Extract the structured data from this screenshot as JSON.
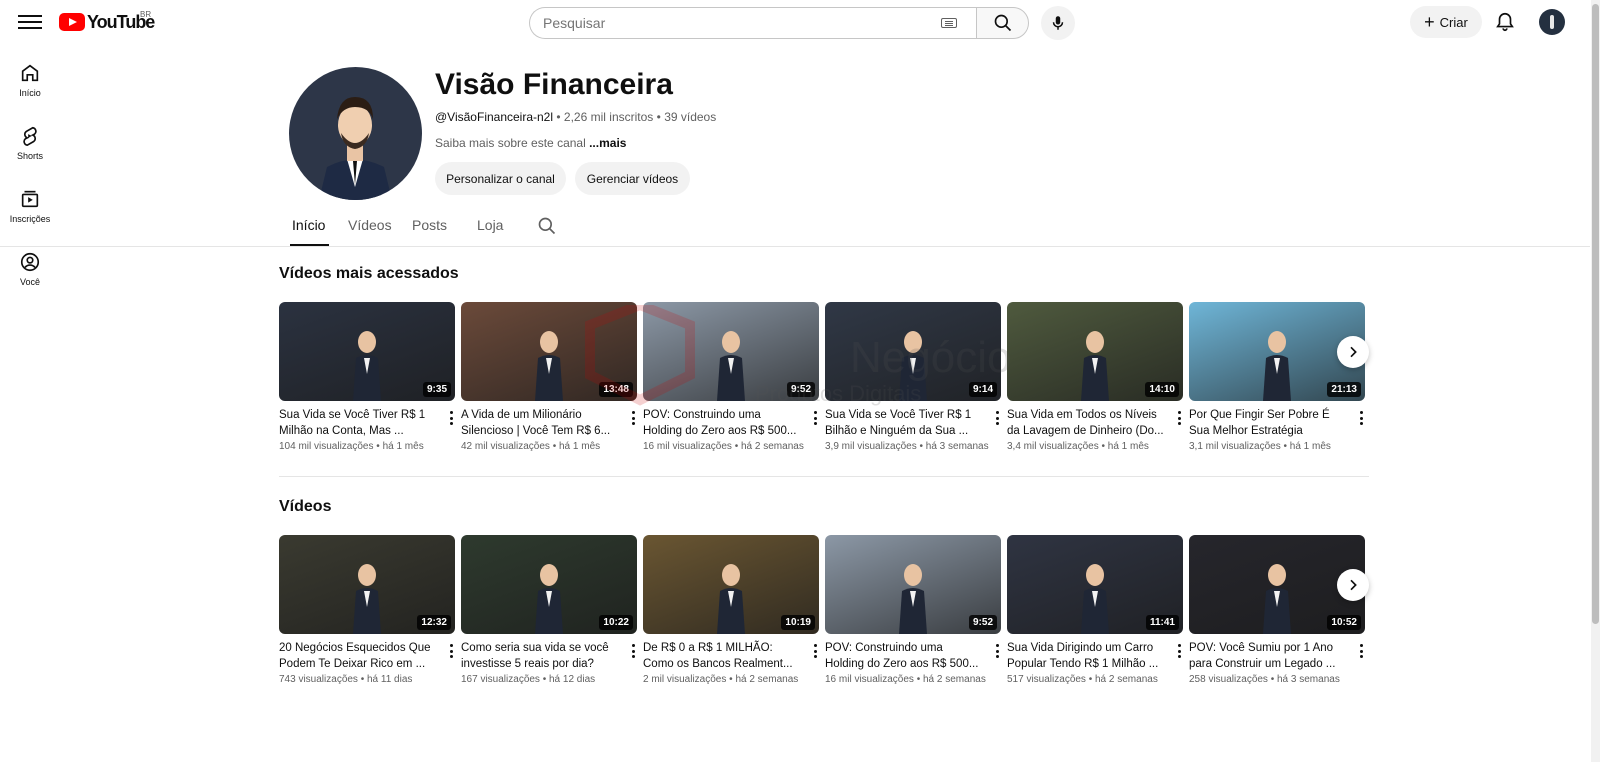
{
  "topbar": {
    "logo_text": "YouTube",
    "country": "BR",
    "search_placeholder": "Pesquisar",
    "create_label": "Criar"
  },
  "leftnav": [
    {
      "label": "Início",
      "icon": "home-icon"
    },
    {
      "label": "Shorts",
      "icon": "shorts-icon"
    },
    {
      "label": "Inscrições",
      "icon": "subscriptions-icon"
    },
    {
      "label": "Você",
      "icon": "user-icon"
    }
  ],
  "channel": {
    "name": "Visão Financeira",
    "handle": "@VisãoFinanceira-n2l",
    "subscribers": "2,26 mil inscritos",
    "videos_count": "39 vídeos",
    "description": "Saiba mais sobre este canal",
    "more": "...mais",
    "customize_label": "Personalizar o canal",
    "manage_label": "Gerenciar vídeos"
  },
  "tabs": [
    {
      "label": "Início",
      "active": true
    },
    {
      "label": "Vídeos",
      "active": false
    },
    {
      "label": "Posts",
      "active": false
    },
    {
      "label": "Loja",
      "active": false
    }
  ],
  "popular": {
    "title": "Vídeos mais acessados",
    "videos": [
      {
        "title": "Sua Vida se Você Tiver R$ 1 Milhão na Conta, Mas ...",
        "views": "104 mil visualizações",
        "age": "há 1 mês",
        "duration": "9:35",
        "thumb": "#2b3240"
      },
      {
        "title": "A Vida de um Milionário Silencioso | Você Tem R$ 6...",
        "views": "42 mil visualizações",
        "age": "há 1 mês",
        "duration": "13:48",
        "thumb": "#6b4a3a"
      },
      {
        "title": "POV: Construindo uma Holding do Zero aos R$ 500...",
        "views": "16 mil visualizações",
        "age": "há 2 semanas",
        "duration": "9:52",
        "thumb": "#8c98a6"
      },
      {
        "title": "Sua Vida se Você Tiver R$ 1 Bilhão e Ninguém da Sua ...",
        "views": "3,9 mil visualizações",
        "age": "há 3 semanas",
        "duration": "9:14",
        "thumb": "#303846"
      },
      {
        "title": "Sua Vida em Todos os Níveis da Lavagem de Dinheiro (Do...",
        "views": "3,4 mil visualizações",
        "age": "há 1 mês",
        "duration": "14:10",
        "thumb": "#4f5a3e"
      },
      {
        "title": "Por Que Fingir Ser Pobre É Sua Melhor Estratégia",
        "views": "3,1 mil visualizações",
        "age": "há 1 mês",
        "duration": "21:13",
        "thumb": "#6fb6d8"
      }
    ]
  },
  "videos": {
    "title": "Vídeos",
    "videos": [
      {
        "title": "20 Negócios Esquecidos Que Podem Te Deixar Rico em ...",
        "views": "743 visualizações",
        "age": "há 11 dias",
        "duration": "12:32",
        "thumb": "#3a3a30"
      },
      {
        "title": "Como seria sua vida se você investisse 5 reais por dia?",
        "views": "167 visualizações",
        "age": "há 12 dias",
        "duration": "10:22",
        "thumb": "#2e3a2e"
      },
      {
        "title": "De R$ 0 a R$ 1 MILHÃO: Como os Bancos Realment...",
        "views": "2 mil visualizações",
        "age": "há 2 semanas",
        "duration": "10:19",
        "thumb": "#6a5632"
      },
      {
        "title": "POV: Construindo uma Holding do Zero aos R$ 500...",
        "views": "16 mil visualizações",
        "age": "há 2 semanas",
        "duration": "9:52",
        "thumb": "#8c98a6"
      },
      {
        "title": "Sua Vida Dirigindo um Carro Popular Tendo R$ 1 Milhão ...",
        "views": "517 visualizações",
        "age": "há 2 semanas",
        "duration": "11:41",
        "thumb": "#2f3442"
      },
      {
        "title": "POV: Você Sumiu por 1 Ano para Construir um Legado ...",
        "views": "258 visualizações",
        "age": "há 3 semanas",
        "duration": "10:52",
        "thumb": "#26262c"
      }
    ]
  },
  "watermark": {
    "big": "Negócio",
    "small": "Produtos Digitais"
  },
  "colors": {
    "brand_red": "#ff0000",
    "text_primary": "#0f0f0f",
    "text_secondary": "#606060",
    "chip_bg": "#f2f2f2"
  }
}
